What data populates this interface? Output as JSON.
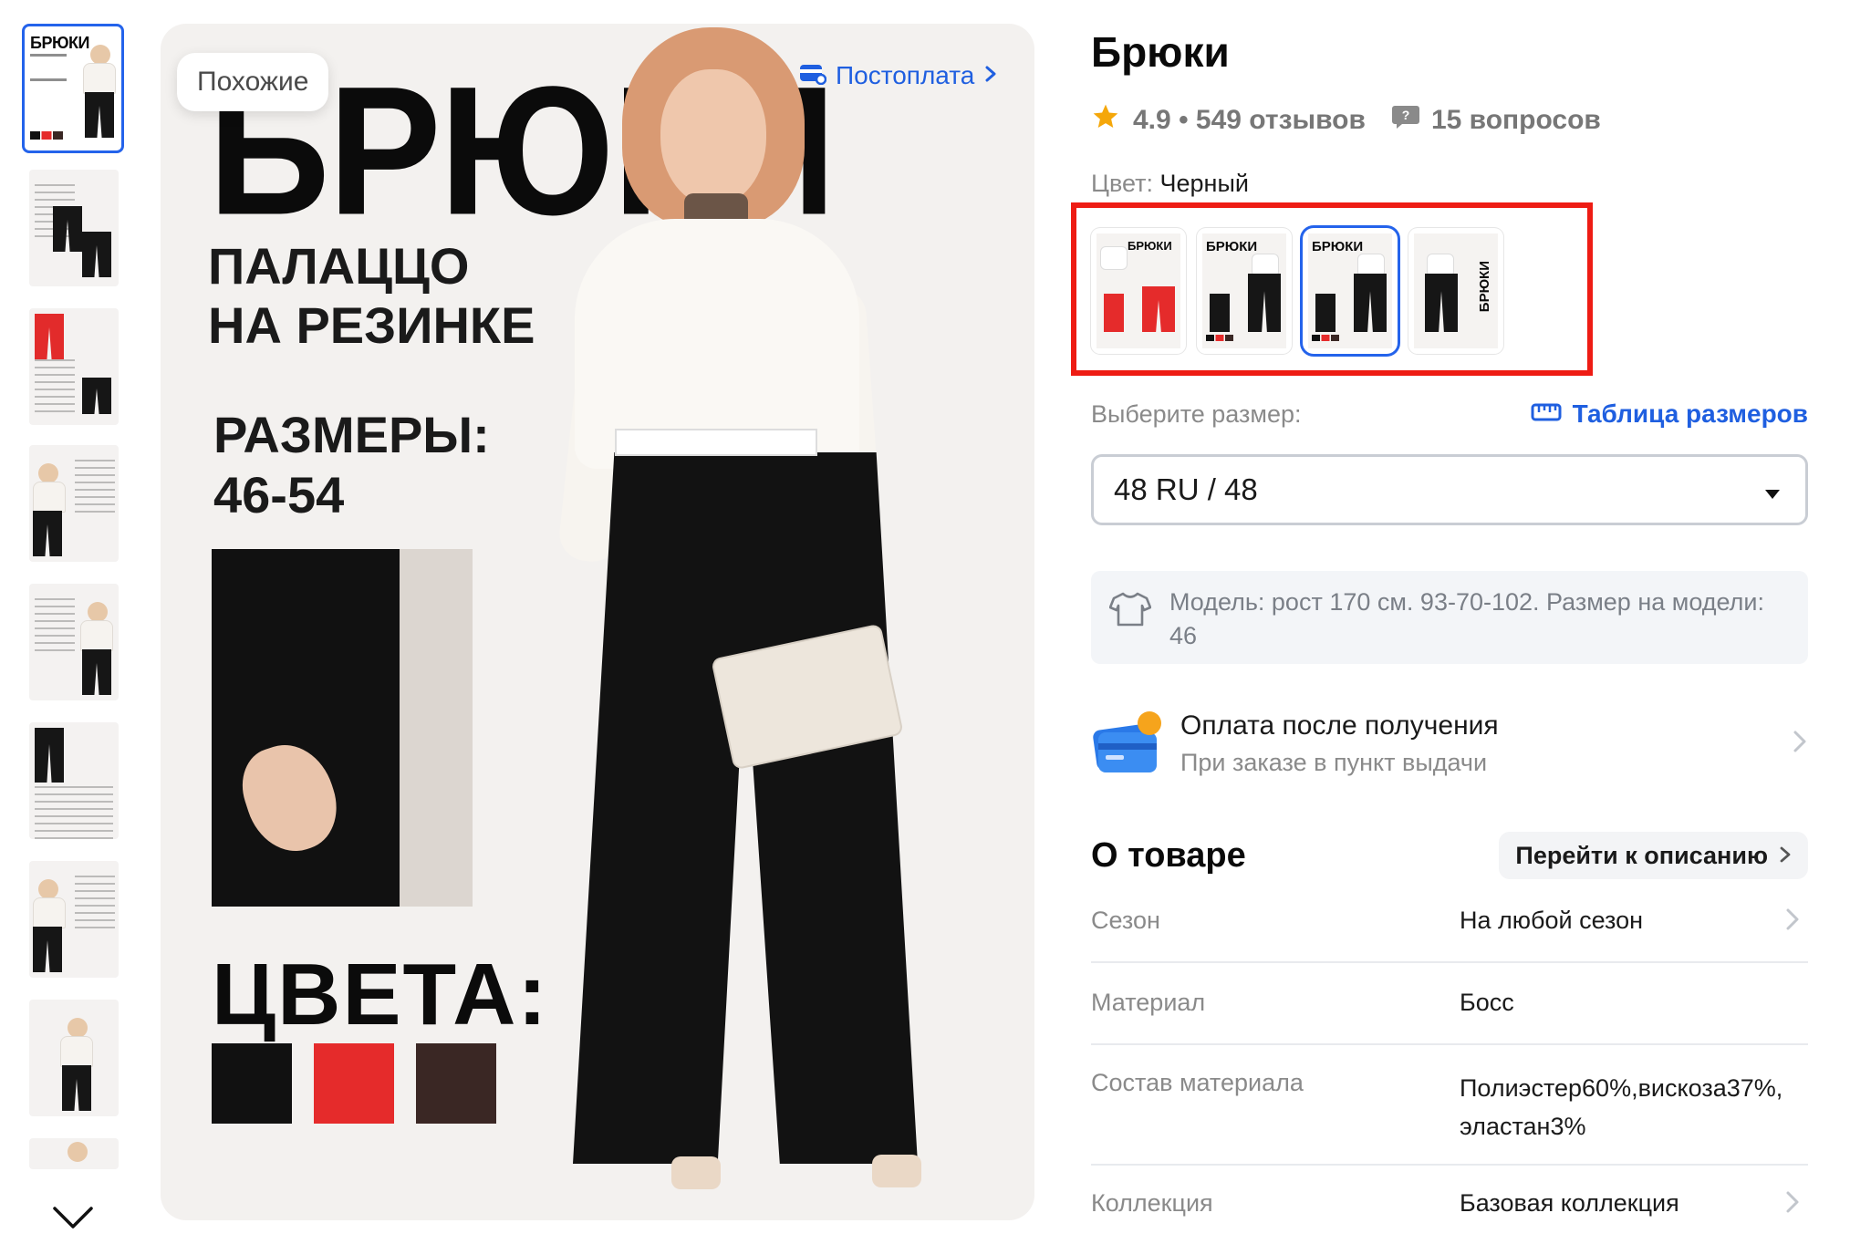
{
  "gallery": {
    "thumb_count": 9,
    "similar_label": "Похожие",
    "postpay_label": "Постоплата",
    "hero": {
      "title": "БРЮКИ",
      "subtitle_line1": "ПАЛАЦЦО",
      "subtitle_line2": "НА РЕЗИНКЕ",
      "sizes_label": "РАЗМЕРЫ:",
      "sizes_value": "46-54",
      "colors_label": "ЦВЕТА:",
      "swatches": [
        "#111111",
        "#e52b2b",
        "#3a2724"
      ]
    }
  },
  "product": {
    "title": "Брюки",
    "rating": "4.9",
    "separator": "•",
    "reviews": "549 отзывов",
    "questions": "15 вопросов",
    "color_label": "Цвет:",
    "color_value": "Черный",
    "variants_highlight_color": "#ee1c14",
    "size_label": "Выберите размер:",
    "size_table_link": "Таблица размеров",
    "size_selected": "48 RU / 48",
    "model_info": "Модель: рост 170 см. 93-70-102. Размер на модели: 46",
    "payment_title": "Оплата после получения",
    "payment_subtitle": "При заказе в пункт выдачи",
    "about_title": "О товаре",
    "goto_description": "Перейти к описанию",
    "properties": [
      {
        "key": "Сезон",
        "value": "На любой сезон"
      },
      {
        "key": "Материал",
        "value": "Босс"
      },
      {
        "key": "Состав материала",
        "value": "Полиэстер60%,вискоза37%, эластан3%"
      },
      {
        "key": "Коллекция",
        "value": "Базовая коллекция"
      }
    ]
  },
  "colors": {
    "accent": "#1f5fe0",
    "selected_border": "#2463eb",
    "star": "#f5a70a"
  }
}
